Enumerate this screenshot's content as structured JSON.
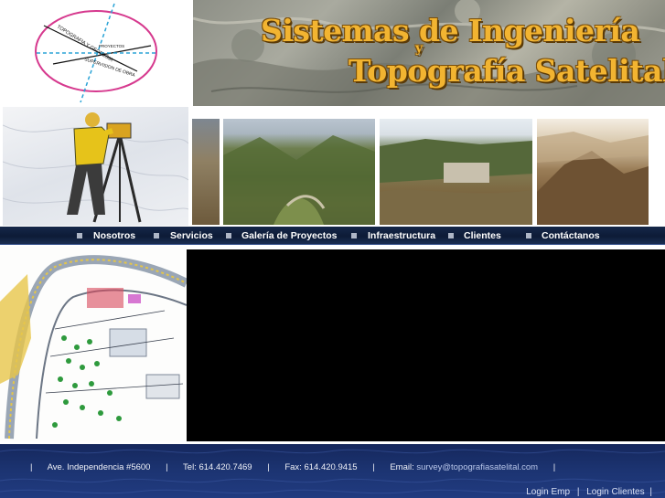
{
  "logo": {
    "label_top": "TOPOGRAFIA Y GEODESIA",
    "label_mid": "PROYECTOS",
    "label_bottom": "SUPERVISION DE OBRA"
  },
  "banner": {
    "title_line1": "Sistemas de Ingeniería",
    "title_y": "y",
    "title_line2": "Topografía Satelital"
  },
  "nav": {
    "items": [
      {
        "label": "Nosotros"
      },
      {
        "label": "Servicios"
      },
      {
        "label": "Galería de Proyectos"
      },
      {
        "label": "Infraestructura"
      },
      {
        "label": "Clientes"
      },
      {
        "label": "Contáctanos"
      }
    ]
  },
  "footer": {
    "address": "Ave. Independencia #5600",
    "tel": "Tel: 614.420.7469",
    "fax": "Fax: 614.420.9415",
    "email_label": "Email:",
    "email": "survey@topografiasatelital.com",
    "login_emp": "Login Emp",
    "login_clientes": "Login Clientes"
  },
  "colors": {
    "title_gold": "#f2b431",
    "nav_bg": "#0d1b36",
    "footer_bg": "#1c3472",
    "logo_ellipse": "#d6398e",
    "logo_dashes": "#2aa3d6"
  },
  "icons": [
    "logo-sphere-icon",
    "nav-bullet-icon"
  ]
}
